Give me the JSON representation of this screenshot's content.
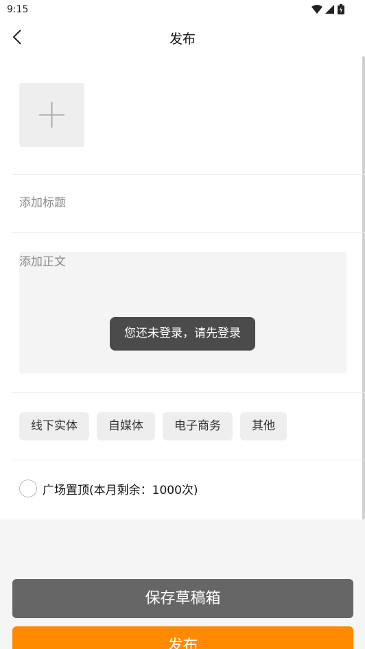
{
  "status_bar": {
    "time": "9:15",
    "icons": [
      "wifi-icon",
      "signal-icon",
      "battery-icon"
    ]
  },
  "header": {
    "title": "发布",
    "back_icon": "back-chevron-icon"
  },
  "form": {
    "add_image_icon": "plus-icon",
    "title_placeholder": "添加标题",
    "title_value": "",
    "body_placeholder": "添加正文",
    "body_value": ""
  },
  "toast": {
    "text": "您还未登录，请先登录"
  },
  "tags": [
    {
      "label": "线下实体"
    },
    {
      "label": "自媒体"
    },
    {
      "label": "电子商务"
    },
    {
      "label": "其他"
    }
  ],
  "pin": {
    "label": "广场置顶(本月剩余：1000次)",
    "checked": false
  },
  "buttons": {
    "save_draft": "保存草稿箱",
    "publish": "发布"
  },
  "colors": {
    "accent": "#ff8a00",
    "draft_button": "#666666",
    "toast_bg": "#4b4b4b"
  }
}
